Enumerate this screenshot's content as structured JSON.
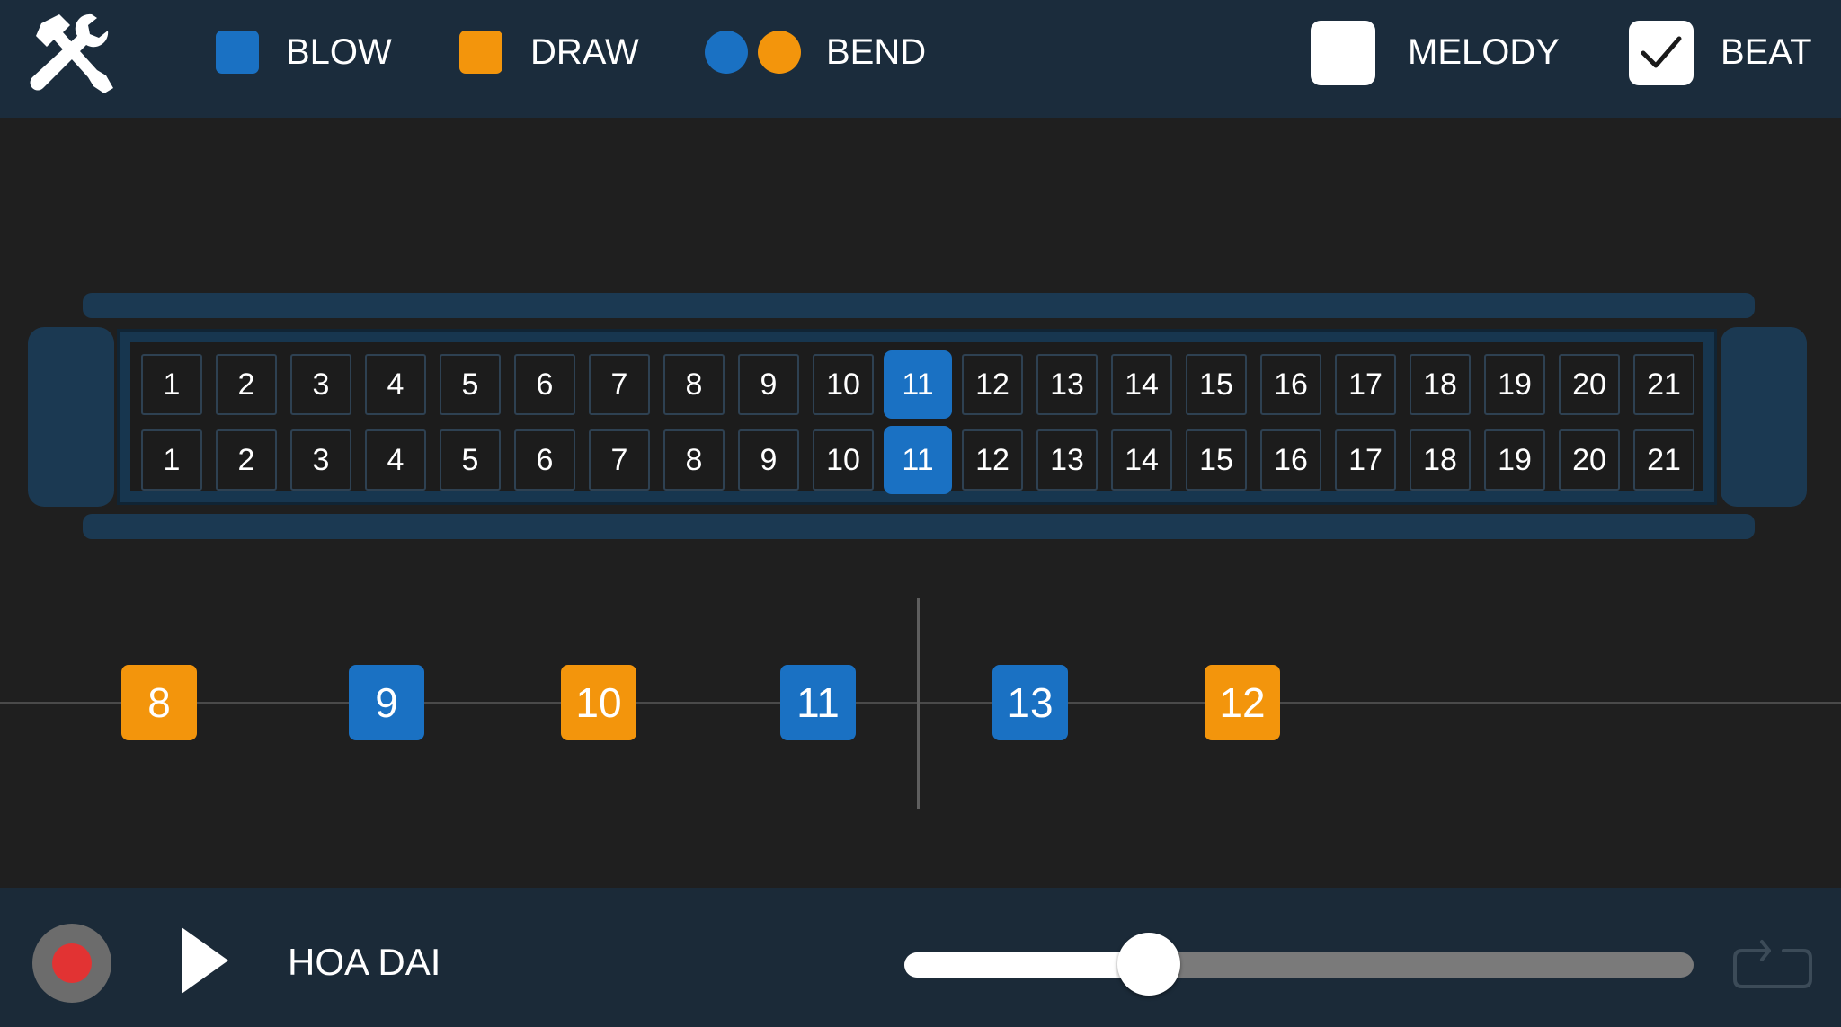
{
  "topbar": {
    "tools_icon": "wrench-screwdriver-icon",
    "legend": {
      "blow_label": "BLOW",
      "draw_label": "DRAW",
      "bend_label": "BEND"
    },
    "melody": {
      "label": "MELODY",
      "checked": false
    },
    "beat": {
      "label": "BEAT",
      "checked": true
    }
  },
  "colors": {
    "blow": "#1a71c3",
    "draw": "#f3950c",
    "topbar_bg": "#1b2c3c",
    "record": "#e23333"
  },
  "harmonica": {
    "active_hole": "11",
    "top_row": [
      "1",
      "2",
      "3",
      "4",
      "5",
      "6",
      "7",
      "8",
      "9",
      "10",
      "11",
      "12",
      "13",
      "14",
      "15",
      "16",
      "17",
      "18",
      "19",
      "20",
      "21"
    ],
    "bottom_row": [
      "1",
      "2",
      "3",
      "4",
      "5",
      "6",
      "7",
      "8",
      "9",
      "10",
      "11",
      "12",
      "13",
      "14",
      "15",
      "16",
      "17",
      "18",
      "19",
      "20",
      "21"
    ]
  },
  "timeline": {
    "notes": [
      {
        "label": "8",
        "type": "draw"
      },
      {
        "label": "9",
        "type": "blow"
      },
      {
        "label": "10",
        "type": "draw"
      },
      {
        "label": "11",
        "type": "blow"
      },
      {
        "label": "13",
        "type": "blow"
      },
      {
        "label": "12",
        "type": "draw"
      }
    ]
  },
  "player": {
    "song_title": "HOA DAI",
    "progress": 0.31,
    "record_icon": "record-icon",
    "play_icon": "play-icon",
    "repeat_icon": "repeat-icon"
  }
}
